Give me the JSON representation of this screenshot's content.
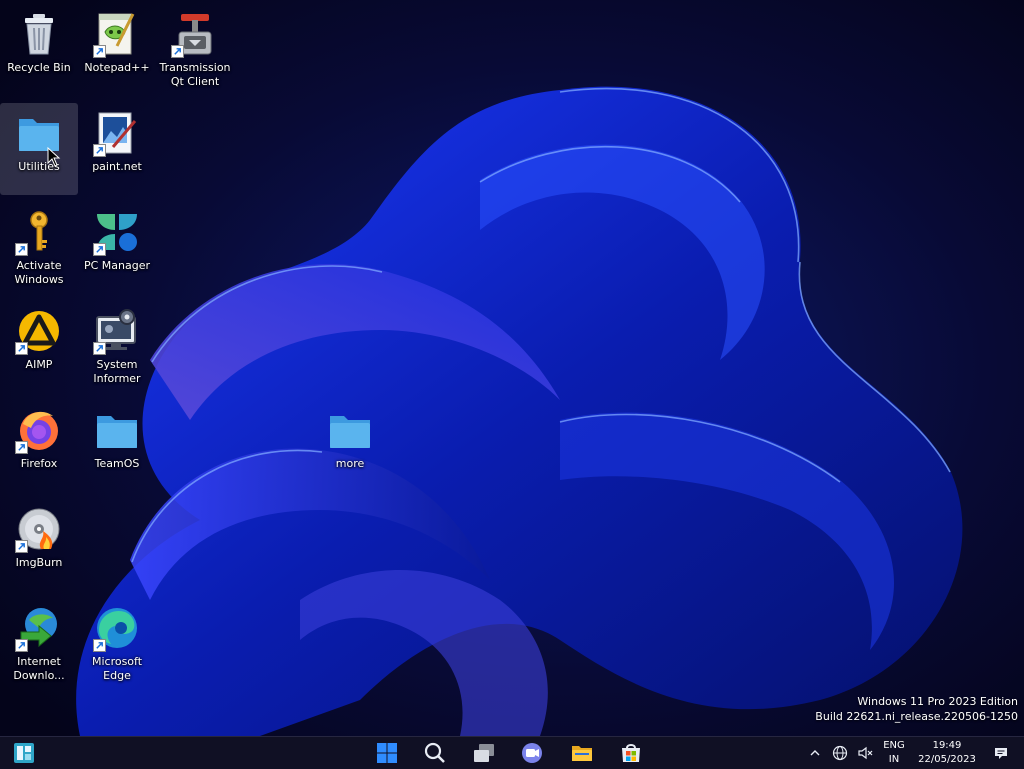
{
  "desktop": {
    "icons": [
      {
        "name": "recycle-bin",
        "label": "Recycle Bin"
      },
      {
        "name": "notepad-plus-plus",
        "label": "Notepad++"
      },
      {
        "name": "transmission-qt-client",
        "label": "Transmission\nQt Client"
      },
      {
        "name": "utilities-folder",
        "label": "Utilities"
      },
      {
        "name": "paint-net",
        "label": "paint.net"
      },
      {
        "name": "activate-windows",
        "label": "Activate\nWindows"
      },
      {
        "name": "pc-manager",
        "label": "PC Manager"
      },
      {
        "name": "aimp",
        "label": "AIMP"
      },
      {
        "name": "system-informer",
        "label": "System\nInformer"
      },
      {
        "name": "firefox",
        "label": "Firefox"
      },
      {
        "name": "teamos-folder",
        "label": "TeamOS"
      },
      {
        "name": "more-folder",
        "label": "more"
      },
      {
        "name": "imgburn",
        "label": "ImgBurn"
      },
      {
        "name": "internet-download-manager",
        "label": "Internet\nDownlo..."
      },
      {
        "name": "microsoft-edge",
        "label": "Microsoft\nEdge"
      }
    ],
    "selected": "utilities-folder"
  },
  "watermark": {
    "line1": "Windows 11 Pro 2023 Edition",
    "line2": "Build 22621.ni_release.220506-1250"
  },
  "taskbar": {
    "items": [
      "widgets-icon",
      "start-icon",
      "search-icon",
      "task-view-icon",
      "teams-chat-icon",
      "file-explorer-icon",
      "microsoft-store-icon"
    ],
    "tray": {
      "language": "ENG",
      "region": "IN",
      "time": "19:49",
      "date": "22/05/2023"
    }
  },
  "colors": {
    "folder": "#5ab4ee",
    "wallpaper_bg": "#06061e",
    "taskbar_bg": "#101024",
    "accent_blue": "#2f5cff"
  }
}
